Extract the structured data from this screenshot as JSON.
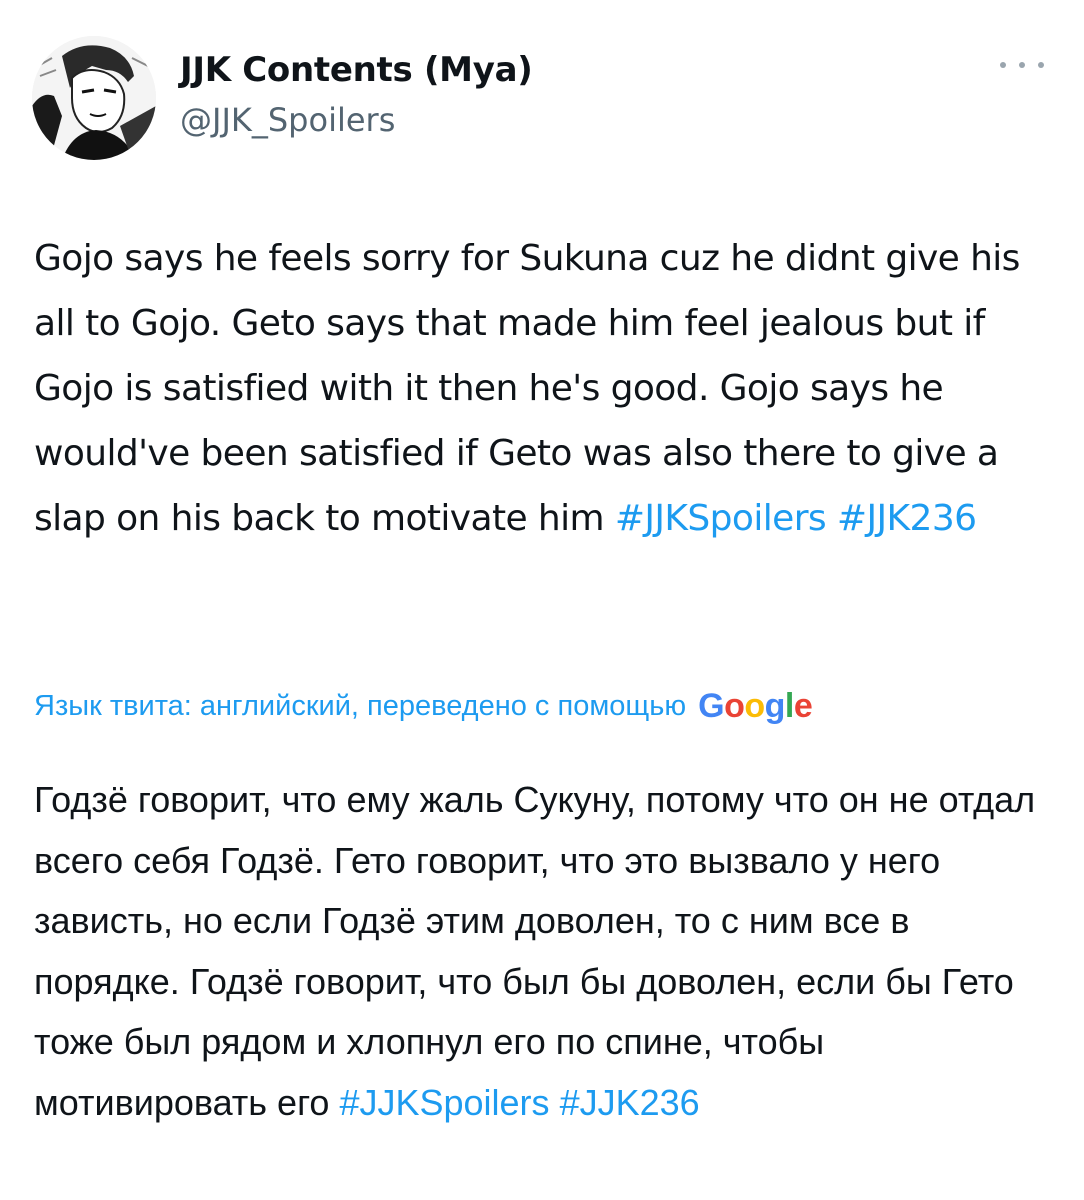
{
  "author": {
    "name": "JJK Contents (Mya)",
    "handle": "@JJK_Spoilers",
    "avatar_icon": "manga-character-avatar"
  },
  "header": {
    "more_icon": "more-options-icon"
  },
  "tweet": {
    "text": "Gojo says he feels sorry for Sukuna cuz he didnt give his all to Gojo. Geto says that made him feel jealous but if Gojo is satisfied with it then he's good. Gojo says he would've been satisfied if Geto was also there to give a slap on his back to motivate him",
    "hashtags": [
      "#JJKSpoilers",
      "#JJK236"
    ]
  },
  "translation": {
    "label": "Язык твита: английский, переведено с помощью",
    "provider_logo": "Google",
    "provider_colors": [
      "#4285F4",
      "#EA4335",
      "#FBBC05",
      "#4285F4",
      "#34A853",
      "#EA4335"
    ],
    "text": "Годзё говорит, что ему жаль Сукуну, потому что он не отдал всего себя Годзё. Гето говорит, что это вызвало у него зависть, но если Годзё этим доволен, то с ним все в порядке. Годзё говорит, что был бы доволен, если бы Гето тоже был рядом и хлопнул его по спине, чтобы мотивировать его",
    "hashtags": [
      "#JJKSpoilers",
      "#JJK236"
    ]
  },
  "colors": {
    "text": "#0f1419",
    "secondary": "#536471",
    "link": "#1d9bf0"
  }
}
